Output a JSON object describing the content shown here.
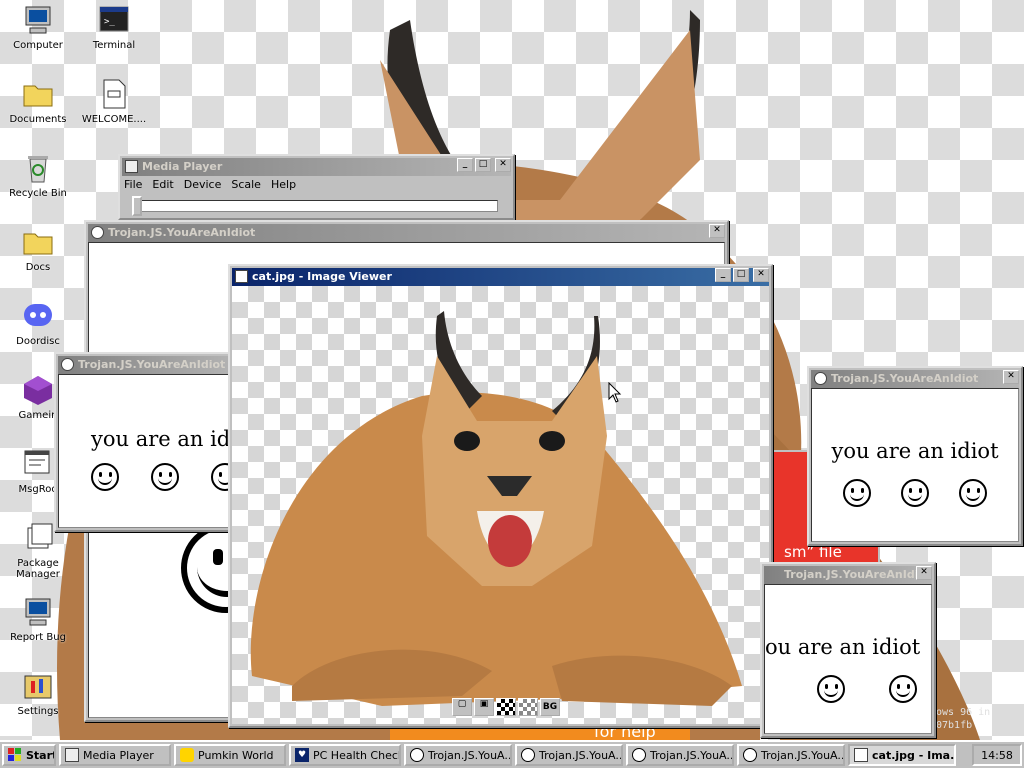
{
  "desktop": {
    "icons": [
      {
        "label": "Computer"
      },
      {
        "label": "Terminal"
      },
      {
        "label": "Documents"
      },
      {
        "label": "WELCOME...."
      },
      {
        "label": "Recycle Bin"
      },
      {
        "label": "Docs"
      },
      {
        "label": "Doordisc"
      },
      {
        "label": "Gamein"
      },
      {
        "label": "MsgRoo"
      },
      {
        "label": "Package Manager"
      },
      {
        "label": "Report Bug"
      },
      {
        "label": "Settings"
      }
    ]
  },
  "media_player": {
    "title": "Media Player",
    "menu": [
      "File",
      "Edit",
      "Device",
      "Scale",
      "Help"
    ]
  },
  "idiot_windows": {
    "title": "Trojan.JS.YouAreAnIdiot",
    "message": "you are an idiot",
    "message_partial_right": "ou are an idiot"
  },
  "image_viewer": {
    "title": "cat.jpg - Image Viewer",
    "toolbar": [
      "",
      "",
      "",
      "",
      "BG"
    ]
  },
  "background_fragments": {
    "ism_file": "sm” file",
    "for_help": "for help",
    "windows_text": "ows 96 in",
    "hash_text": "07b1fb"
  },
  "taskbar": {
    "start": "Start",
    "items": [
      {
        "label": "Media Player",
        "pressed": false
      },
      {
        "label": "Pumkin World",
        "pressed": false
      },
      {
        "label": "PC Health Check",
        "pressed": false
      },
      {
        "label": "Trojan.JS.YouA...",
        "pressed": false
      },
      {
        "label": "Trojan.JS.YouA...",
        "pressed": false
      },
      {
        "label": "Trojan.JS.YouA...",
        "pressed": false
      },
      {
        "label": "Trojan.JS.YouA...",
        "pressed": false
      },
      {
        "label": "cat.jpg - Ima...",
        "pressed": true
      }
    ],
    "clock": "14:58"
  },
  "colors": {
    "accent_titlebar": "#0a246a",
    "cat_fur": "#c98a4b",
    "alert_red": "#e8342a"
  }
}
